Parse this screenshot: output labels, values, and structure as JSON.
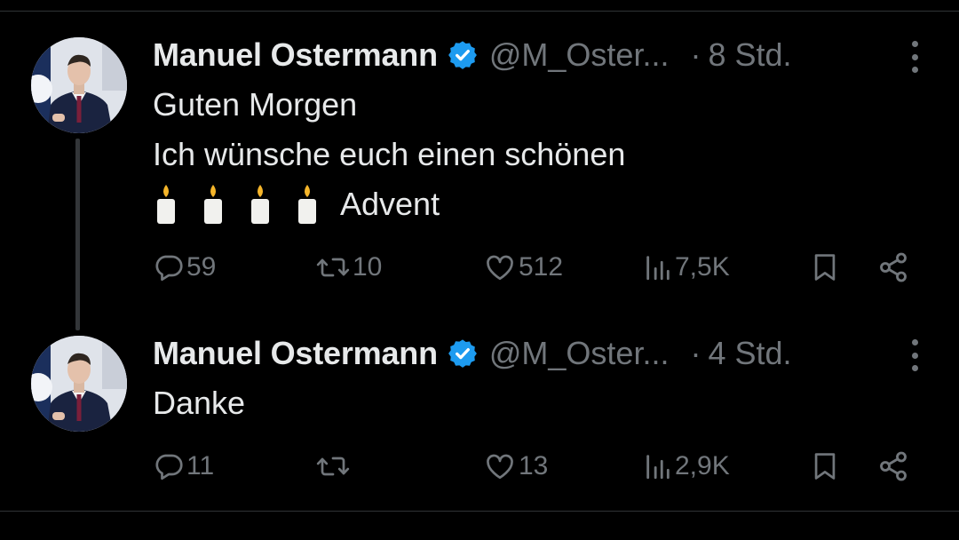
{
  "thread": {
    "tweets": [
      {
        "author_name": "Manuel Ostermann",
        "handle": "@M_Oster...",
        "separator": "·",
        "time": "8 Std.",
        "text_lines": [
          "Guten Morgen",
          "Ich wünsche euch einen schönen"
        ],
        "candle_line_text": "Advent",
        "candles": [
          "🕯",
          "🕯",
          "🕯",
          "🕯"
        ],
        "metrics": {
          "replies": "59",
          "retweets": "10",
          "likes": "512",
          "views": "7,5K"
        }
      },
      {
        "author_name": "Manuel Ostermann",
        "handle": "@M_Oster...",
        "separator": "·",
        "time": "4 Std.",
        "text_lines": [
          "Danke"
        ],
        "metrics": {
          "replies": "11",
          "retweets": "",
          "likes": "13",
          "views": "2,9K"
        }
      }
    ]
  },
  "colors": {
    "background": "#000000",
    "text_primary": "#e7e9ea",
    "text_secondary": "#71767b",
    "verified": "#1d9bf0",
    "divider": "#2f3336"
  },
  "icons": {
    "verified": "verified-badge-icon",
    "more": "more-vertical-icon",
    "reply": "reply-icon",
    "retweet": "retweet-icon",
    "like": "heart-icon",
    "views": "views-icon",
    "bookmark": "bookmark-icon",
    "share": "share-icon",
    "candle": "candle-icon"
  }
}
